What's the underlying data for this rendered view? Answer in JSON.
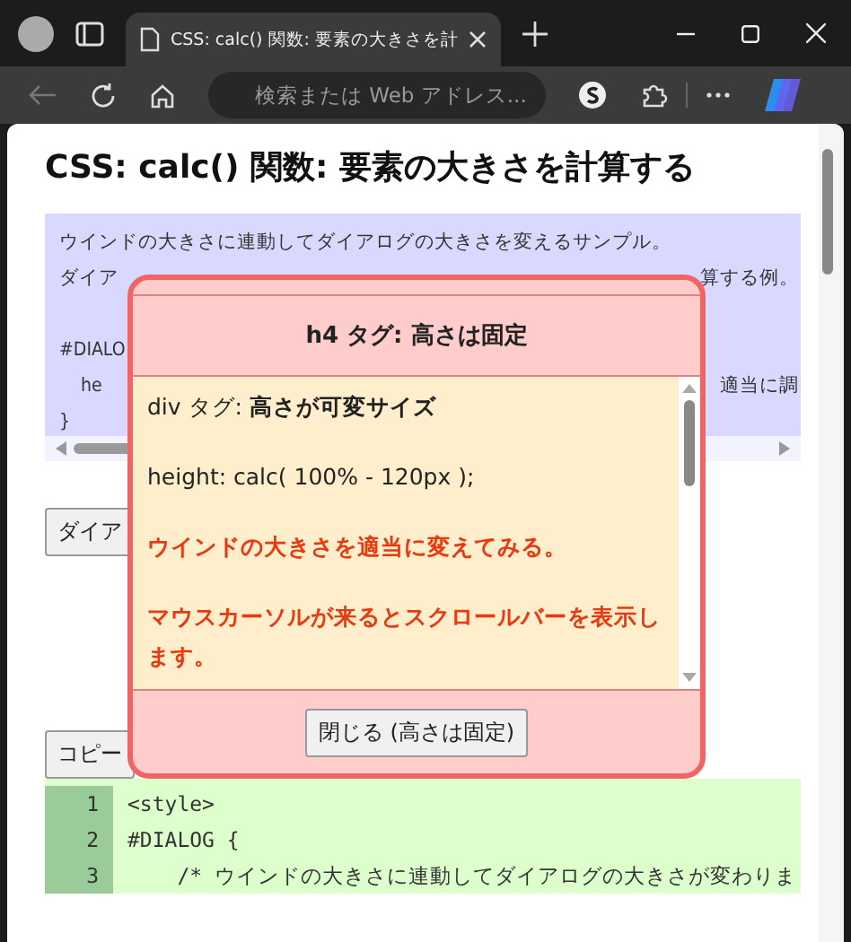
{
  "browser": {
    "tab_title": "CSS: calc() 関数: 要素の大きさを計",
    "address_placeholder": "検索または Web アドレス..."
  },
  "page": {
    "title": "CSS: calc() 関数: 要素の大きさを計算する",
    "demo_lines": [
      {
        "left": "ウインドの大きさに連動してダイアログの大きさを変えるサンプル。"
      },
      {
        "left": "ダイア",
        "right": "算する例。"
      },
      {
        "left": "#DIALO",
        "gap_before": true
      },
      {
        "left": "    he",
        "right": "適当に調"
      },
      {
        "left": "}"
      }
    ],
    "open_button": "ダイア",
    "copy_button": "コピー",
    "code_lines": [
      {
        "number": "1",
        "code": "<style>"
      },
      {
        "number": "2",
        "code": "#DIALOG {"
      },
      {
        "number": "3",
        "code": "    /* ウインドの大きさに連動してダイアログの大きさが変わりま"
      }
    ]
  },
  "dialog": {
    "title": "h4 タグ: 高さは固定",
    "paragraphs": [
      {
        "kind": "plain",
        "text": "div タグ: **高さが可変サイズ**"
      },
      {
        "kind": "plain",
        "text": "height: calc( 100% - 120px );"
      },
      {
        "kind": "emphasis",
        "text": "ウインドの大きさを適当に変えてみる。"
      },
      {
        "kind": "emphasis",
        "text": "マウスカーソルが来るとスクロールバーを表示します。"
      }
    ],
    "close_button": "閉じる (高さは固定)"
  }
}
